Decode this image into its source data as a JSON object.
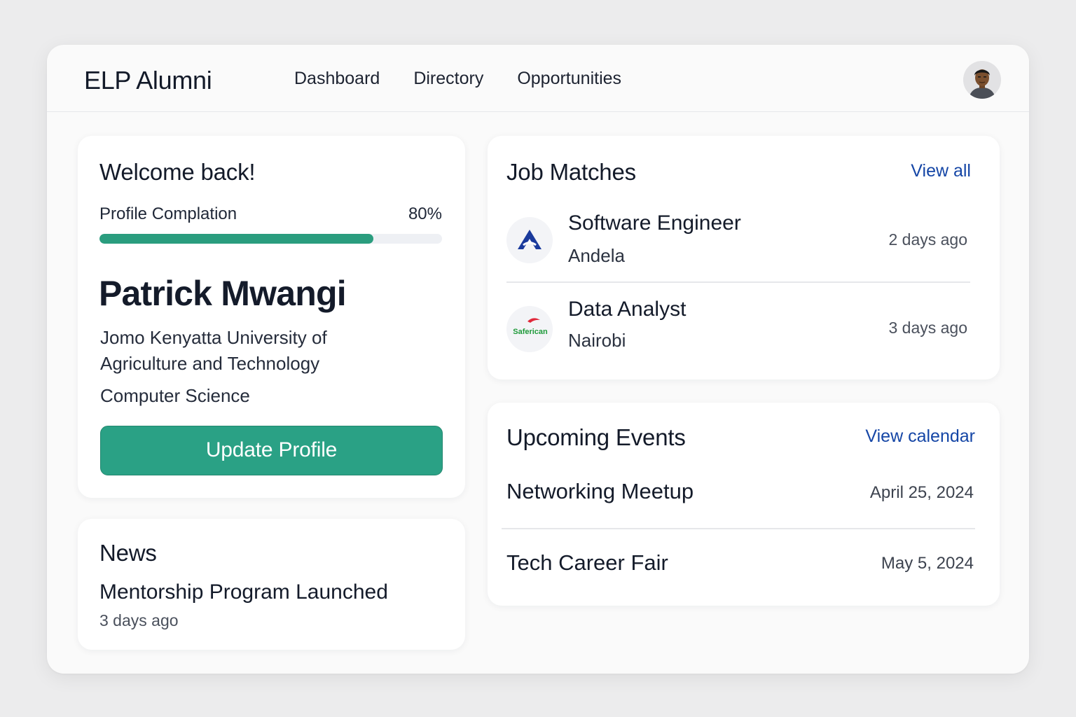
{
  "header": {
    "brand": "ELP Alumni",
    "nav": [
      "Dashboard",
      "Directory",
      "Opportunities"
    ]
  },
  "welcome": {
    "title": "Welcome back!",
    "progress_label": "Profile Complation",
    "progress_value_text": "80%",
    "progress_fraction": 0.8,
    "name": "Patrick Mwangi",
    "university": "Jomo Kenyatta University of Agriculture and Technology",
    "major": "Computer Science",
    "update_button": "Update Profile"
  },
  "news": {
    "title": "News",
    "items": [
      {
        "title": "Mentorship Program Launched",
        "time": "3 days ago"
      }
    ]
  },
  "jobs": {
    "title": "Job Matches",
    "view_all": "View all",
    "items": [
      {
        "title": "Software Engineer",
        "company": "Andela",
        "time": "2 days ago",
        "logo_text": ""
      },
      {
        "title": "Data Analyst",
        "company": "Nairobi",
        "time": "3 days ago",
        "logo_text": "Saferican"
      }
    ]
  },
  "events": {
    "title": "Upcoming Events",
    "view_calendar": "View calendar",
    "items": [
      {
        "name": "Networking Meetup",
        "date": "April 25, 2024"
      },
      {
        "name": "Tech Career Fair",
        "date": "May 5, 2024"
      }
    ]
  },
  "colors": {
    "accent": "#2aa185",
    "progress": "#2a9d7e",
    "link": "#1546a6",
    "andela_blue": "#1a3a9c",
    "saferican_green": "#1e9a3a",
    "saferican_red": "#e0283a"
  }
}
